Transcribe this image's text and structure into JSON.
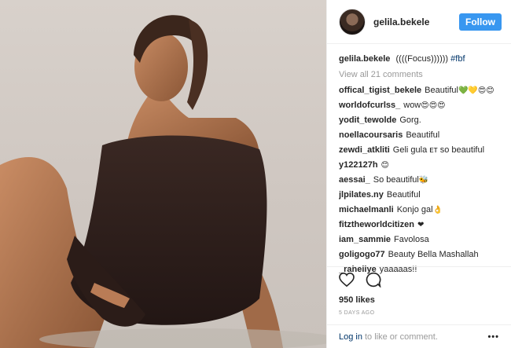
{
  "header": {
    "username": "gelila.bekele",
    "follow_label": "Follow"
  },
  "caption": {
    "username": "gelila.bekele",
    "text": "((((Focus))))))",
    "hashtag": "#fbf"
  },
  "view_all_label": "View all 21 comments",
  "comments": [
    {
      "user": "offical_tigist_bekele",
      "text": "Beautiful",
      "emoji": "💚💛😍😊"
    },
    {
      "user": "worldofcurlss_",
      "text": "wow",
      "emoji": "😍😍😍"
    },
    {
      "user": "yodit_tewolde",
      "text": "Gorg.",
      "emoji": ""
    },
    {
      "user": "noellacoursaris",
      "text": "Beautiful",
      "emoji": ""
    },
    {
      "user": "zewdi_atkliti",
      "text": "Geli gula ᴇᴛ so beautiful",
      "emoji": ""
    },
    {
      "user": "y122127h",
      "text": "",
      "emoji": "😊"
    },
    {
      "user": "aessai_",
      "text": "So beautiful",
      "emoji": "🐝"
    },
    {
      "user": "jlpilates.ny",
      "text": "Beautiful",
      "emoji": ""
    },
    {
      "user": "michaelmanli",
      "text": "Konjo gal",
      "emoji": "👌"
    },
    {
      "user": "fitztheworldcitizen",
      "text": "",
      "emoji": "❤"
    },
    {
      "user": "iam_sammie",
      "text": "Favolosa",
      "emoji": ""
    },
    {
      "user": "goligogo77",
      "text": "Beauty Bella Mashallah",
      "emoji": ""
    },
    {
      "user": "_raheliye",
      "text": "yaaaaas!!",
      "emoji": ""
    }
  ],
  "likes_label": "950 likes",
  "date_label": "5 DAYS AGO",
  "login": {
    "link_label": "Log in",
    "suffix": "to like or comment.",
    "more_label": "•••"
  },
  "colors": {
    "follow_bg": "#3897f0",
    "link": "#003569",
    "muted": "#999999"
  }
}
